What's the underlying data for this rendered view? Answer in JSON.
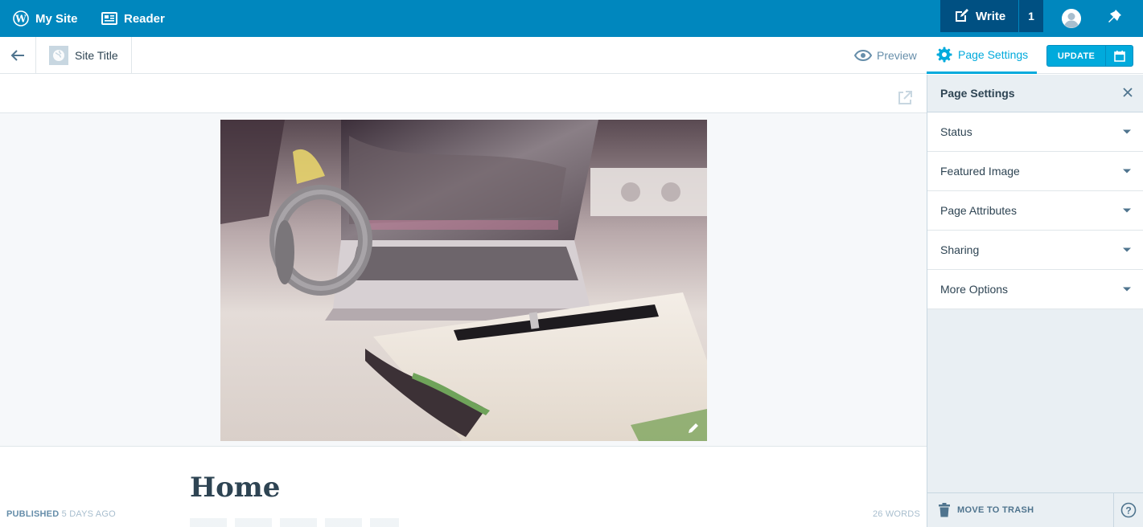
{
  "masterbar": {
    "my_site_label": "My Site",
    "reader_label": "Reader",
    "write_label": "Write",
    "write_count": "1"
  },
  "toolbar": {
    "site_title": "Site Title",
    "preview_label": "Preview",
    "page_settings_label": "Page Settings",
    "update_label": "UPDATE"
  },
  "editor": {
    "page_title": "Home",
    "status_label": "PUBLISHED",
    "status_time": "5 DAYS AGO",
    "word_count": "26 WORDS"
  },
  "sidebar": {
    "title": "Page Settings",
    "sections": [
      {
        "label": "Status"
      },
      {
        "label": "Featured Image"
      },
      {
        "label": "Page Attributes"
      },
      {
        "label": "Sharing"
      },
      {
        "label": "More Options"
      }
    ],
    "trash_label": "MOVE TO TRASH"
  },
  "colors": {
    "masterbar": "#0087be",
    "write_bg": "#005082",
    "accent": "#00aadc",
    "sidebar_bg": "#e9eff3"
  }
}
